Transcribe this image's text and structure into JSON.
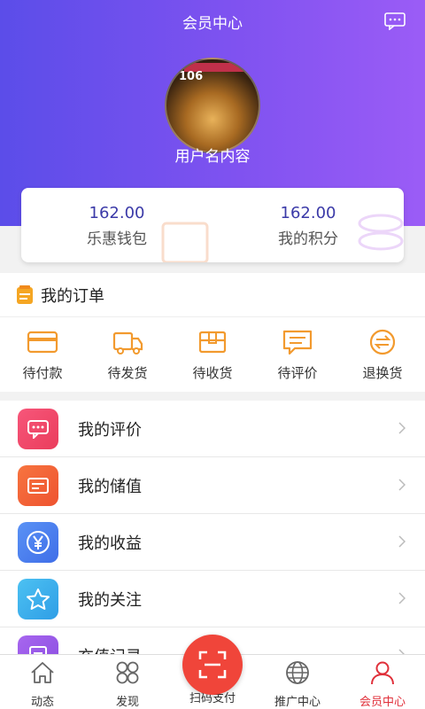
{
  "header": {
    "title": "会员中心",
    "message_icon": "message-icon"
  },
  "profile": {
    "username": "用户名内容",
    "avatar_text": "106"
  },
  "wallet": [
    {
      "value": "162.00",
      "label": "乐惠钱包"
    },
    {
      "value": "162.00",
      "label": "我的积分"
    }
  ],
  "orders": {
    "title": "我的订单",
    "items": [
      {
        "label": "待付款",
        "icon": "card-icon"
      },
      {
        "label": "待发货",
        "icon": "truck-icon"
      },
      {
        "label": "待收货",
        "icon": "box-icon"
      },
      {
        "label": "待评价",
        "icon": "comment-icon"
      },
      {
        "label": "退换货",
        "icon": "exchange-icon"
      }
    ]
  },
  "menu": [
    {
      "label": "我的评价",
      "color": "#f04b6a"
    },
    {
      "label": "我的储值",
      "color": "#f2623a"
    },
    {
      "label": "我的收益",
      "color": "#4d7ef0"
    },
    {
      "label": "我的关注",
      "color": "#3fb0ee"
    },
    {
      "label": "充值记录",
      "color": "#9a5be8"
    }
  ],
  "tabbar": [
    {
      "label": "动态",
      "icon": "home-icon"
    },
    {
      "label": "发现",
      "icon": "discover-icon"
    },
    {
      "label": "扫码支付",
      "icon": "scan-icon"
    },
    {
      "label": "推广中心",
      "icon": "globe-icon"
    },
    {
      "label": "会员中心",
      "icon": "user-icon",
      "active": true
    }
  ],
  "colors": {
    "accent": "#e0303a",
    "header_start": "#5b4de9",
    "header_end": "#9b5cf6",
    "order_icon": "#f29a2e"
  }
}
